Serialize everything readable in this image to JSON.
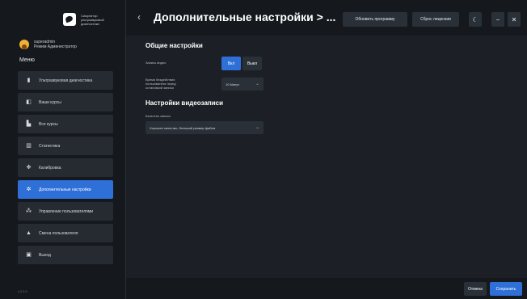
{
  "sidebar": {
    "logo_text": "Симулятор ультразвуковой диагностики",
    "user": {
      "name": "superadmin",
      "mode": "Режим Администратор"
    },
    "menu_title": "Меню",
    "items": [
      {
        "label": "Ультразвуковая диагностика",
        "icon": "device-icon",
        "glyph": "▮",
        "active": false
      },
      {
        "label": "Ваши курсы",
        "icon": "book-icon",
        "glyph": "◧",
        "active": false
      },
      {
        "label": "Все курсы",
        "icon": "library-icon",
        "glyph": "▙",
        "active": false
      },
      {
        "label": "Статистика",
        "icon": "chart-icon",
        "glyph": "▥",
        "active": false
      },
      {
        "label": "Калибровка",
        "icon": "crosshair-icon",
        "glyph": "✥",
        "active": false
      },
      {
        "label": "Дополнительные настройки",
        "icon": "gear-icon",
        "glyph": "✲",
        "active": true
      },
      {
        "label": "Управление пользователями",
        "icon": "users-icon",
        "glyph": "⁂",
        "active": false
      },
      {
        "label": "Смена пользователя",
        "icon": "user-switch-icon",
        "glyph": "▲",
        "active": false
      },
      {
        "label": "Выход",
        "icon": "exit-icon",
        "glyph": "▣",
        "active": false
      }
    ],
    "version": "v.2.0.0"
  },
  "header": {
    "back_glyph": "‹",
    "title": "Дополнительные настройки > ...",
    "update_label": "Обновить программу",
    "reset_license_label": "Сброс лицензии",
    "theme_glyph": "☾",
    "minimize_glyph": "−",
    "close_glyph": "✕"
  },
  "general": {
    "title": "Общие настройки",
    "video_record": {
      "label": "Запись видео",
      "on_label": "Вкл",
      "off_label": "Выкл",
      "selected": "Вкл"
    },
    "user_inactivity": {
      "label": "Время бездействия пользователя перед остановкой записи",
      "value": "10 Минут"
    }
  },
  "video": {
    "title": "Настройки видеозаписи",
    "quality": {
      "label": "Качество записи",
      "value": "Хорошее качество, большой размер файла"
    }
  },
  "footer": {
    "cancel_label": "Отмена",
    "save_label": "Сохранить"
  },
  "colors": {
    "accent": "#2f6fd8",
    "background": "#1c2026",
    "panel": "#15191e",
    "control": "#2a3038"
  }
}
